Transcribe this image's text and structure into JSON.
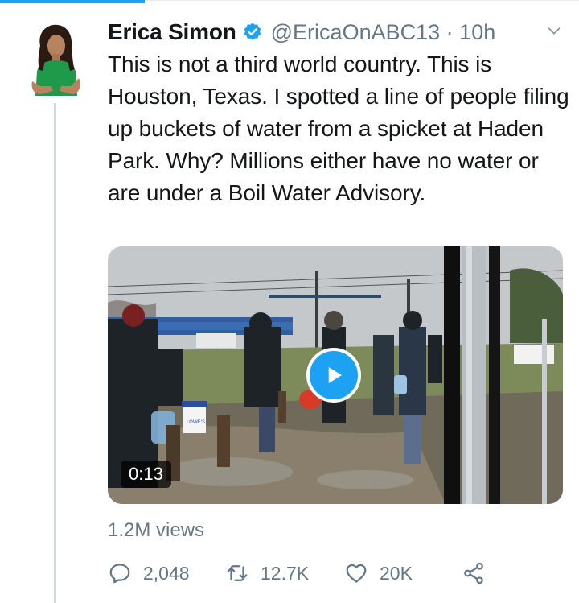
{
  "tweet": {
    "author_name": "Erica Simon",
    "handle": "@EricaOnABC13",
    "separator": "·",
    "time": "10h",
    "text": "This is not a third world country. This is Houston, Texas. I spotted a line of people filing up buckets of water from a spicket at Haden Park. Why? Millions either have no water or are under a Boil Water Advisory.",
    "verified": true
  },
  "media": {
    "type": "video",
    "duration": "0:13",
    "bucket_label": "LOWE'S"
  },
  "views": "1.2M views",
  "actions": {
    "reply_count": "2,048",
    "retweet_count": "12.7K",
    "like_count": "20K"
  },
  "colors": {
    "accent": "#1da1f2",
    "secondary_text": "#657786",
    "primary_text": "#14171a"
  }
}
